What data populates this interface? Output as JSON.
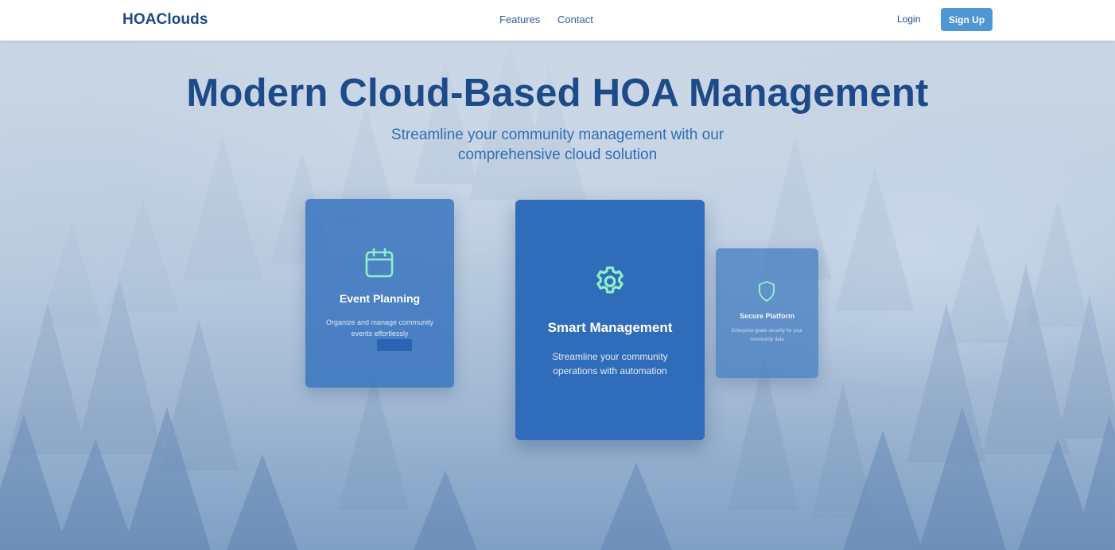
{
  "nav": {
    "brand": "HOAClouds",
    "links": [
      {
        "label": "Features"
      },
      {
        "label": "Contact"
      }
    ],
    "login_label": "Login",
    "signup_label": "Sign Up"
  },
  "hero": {
    "title": "Modern Cloud-Based HOA Management",
    "subtitle": "Streamline your community management with our comprehensive cloud solution"
  },
  "cards": [
    {
      "title": "Event Planning",
      "description": "Organize and manage community events effortlessly",
      "icon": "calendar-icon"
    },
    {
      "title": "Smart Management",
      "description": "Streamline your community operations with automation",
      "icon": "gear-icon"
    },
    {
      "title": "Secure Platform",
      "description": "Enterprise-grade security for your community data",
      "icon": "shield-icon"
    }
  ],
  "colors": {
    "brand_navy": "#1c4a86",
    "accent_blue": "#4f97d4",
    "card_blue": "#2f6cb9",
    "icon_mint": "#8ff0c8"
  }
}
